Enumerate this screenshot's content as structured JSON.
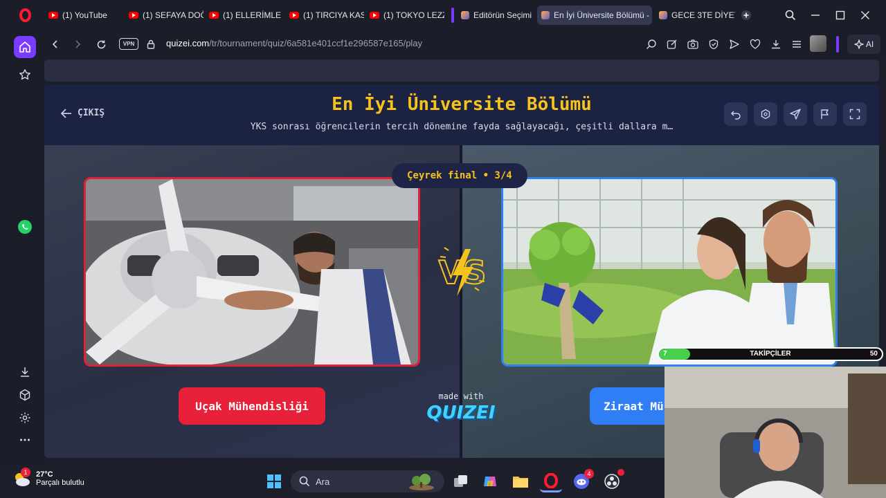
{
  "tabs": [
    {
      "label": "(1) YouTube",
      "icon": "youtube-icon"
    },
    {
      "label": "(1) SEFAYA DOĞ",
      "icon": "youtube-icon"
    },
    {
      "label": "(1) ELLERİMLE P",
      "icon": "youtube-icon"
    },
    {
      "label": "(1) TIRCIYA KASI",
      "icon": "youtube-icon"
    },
    {
      "label": "(1) TOKYO LEZZ",
      "icon": "youtube-icon"
    },
    {
      "label": "Editörün Seçimi",
      "icon": "quizei-favicon"
    },
    {
      "label": "En İyi Üniversite Bölümü -",
      "icon": "quizei-favicon",
      "active": true
    },
    {
      "label": "GECE 3TE DİYET",
      "icon": "quizei-favicon"
    }
  ],
  "address": {
    "vpn_label": "VPN",
    "url_domain": "quizei.com",
    "url_path": "/tr/tournament/quiz/6a581e401ccf1e296587e165/play",
    "ai_label": "AI"
  },
  "quiz": {
    "exit_label": "ÇIKIŞ",
    "title": "En İyi Üniversite Bölümü",
    "subtitle": "YKS sonrası öğrencilerin tercih dönemine fayda sağlayacağı, çeşitli dallara m…",
    "round_label": "Çeyrek final • 3/4",
    "vs_label": "VS",
    "left_choice": "Uçak Mühendisliği",
    "right_choice": "Ziraat Mü",
    "made_with": "made with",
    "brand": "QUIZEI"
  },
  "overlay": {
    "followers_label": "TAKİPÇİLER",
    "followers_current": "7",
    "followers_goal": "50",
    "progress": 0.14
  },
  "taskbar": {
    "weather_temp": "27°C",
    "weather_desc": "Parçalı bulutlu",
    "weather_badge": "1",
    "search_placeholder": "Ara",
    "discord_badge": "4"
  },
  "colors": {
    "accent_purple": "#7a3cff",
    "title_yellow": "#f6c21c",
    "red_choice": "#e8203a",
    "blue_choice": "#2f7ef5"
  }
}
